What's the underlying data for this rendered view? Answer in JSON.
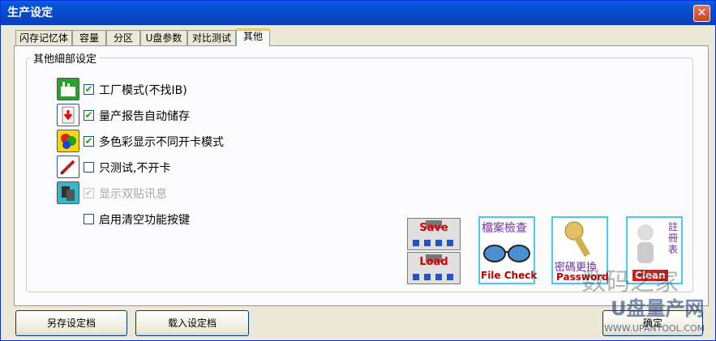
{
  "window": {
    "title": "生产设定",
    "close_glyph": "✕"
  },
  "tabs": [
    {
      "label": "闪存记忆体"
    },
    {
      "label": "容量"
    },
    {
      "label": "分区"
    },
    {
      "label": "U盘参数"
    },
    {
      "label": "对比测试"
    },
    {
      "label": "其他"
    }
  ],
  "group": {
    "legend": "其他細部设定"
  },
  "options": [
    {
      "label": "工厂模式(不找IB)",
      "checked": "✔",
      "icon": "factory-icon"
    },
    {
      "label": "量产报告自动储存",
      "checked": "✔",
      "icon": "report-save-icon"
    },
    {
      "label": "多色彩显示不同开卡模式",
      "checked": "✔",
      "icon": "multicolor-icon"
    },
    {
      "label": "只测试,不开卡",
      "checked": "",
      "icon": "test-pen-icon"
    },
    {
      "label": "显示双贴讯息",
      "checked": "✔",
      "icon": "dual-chip-icon"
    },
    {
      "label": "启用清空功能按键",
      "checked": ""
    }
  ],
  "tool_buttons": {
    "save": "Save",
    "load": "Load"
  },
  "tiles": {
    "filecheck_cn": "檔案檢查",
    "filecheck_en": "File Check",
    "password_cn": "密碼更換",
    "password_en": "Password",
    "clean_cn": "註冊表",
    "clean_en": "Clean"
  },
  "buttons": {
    "save_as": "另存设定档",
    "load_config": "载入设定档",
    "ok": "确定"
  },
  "watermarks": {
    "line1": "数码之家",
    "line2": "U盘量产网",
    "url": "WWW.UPANTOOL.COM"
  }
}
